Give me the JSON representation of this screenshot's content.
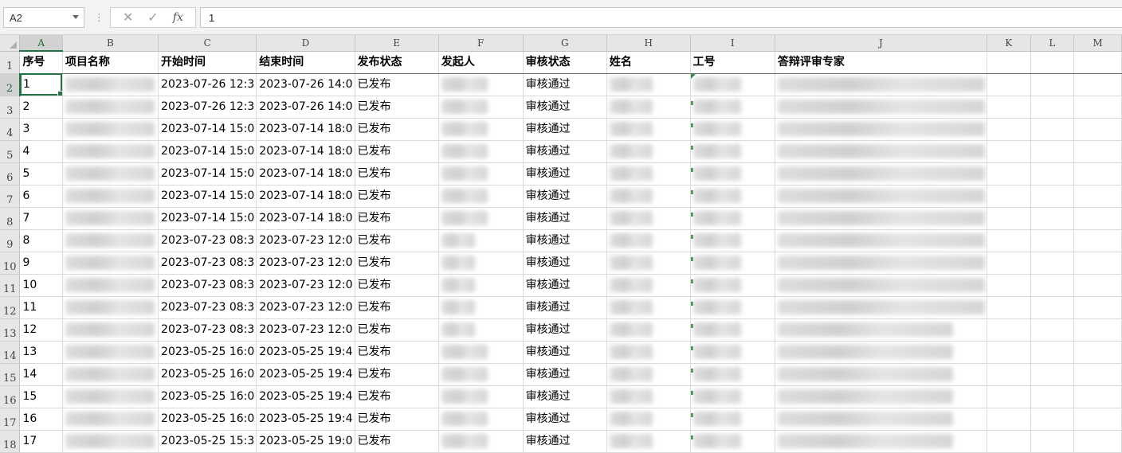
{
  "formula_bar": {
    "name_box": "A2",
    "cancel_icon": "✕",
    "enter_icon": "✓",
    "fx_label": "fx",
    "formula_value": "1"
  },
  "columns": [
    "A",
    "B",
    "C",
    "D",
    "E",
    "F",
    "G",
    "H",
    "I",
    "J",
    "K",
    "L",
    "M"
  ],
  "header_row": {
    "row_number": "1",
    "cells": [
      "序号",
      "项目名称",
      "开始时间",
      "结束时间",
      "发布状态",
      "发起人",
      "审核状态",
      "姓名",
      "工号",
      "答辩评审专家",
      "",
      "",
      ""
    ]
  },
  "rows": [
    {
      "row_number": "2",
      "seq": "1",
      "start": "2023-07-26 12:3",
      "end": "2023-07-26 14:0",
      "publish": "已发布",
      "review": "审核通过"
    },
    {
      "row_number": "3",
      "seq": "2",
      "start": "2023-07-26 12:3",
      "end": "2023-07-26 14:0",
      "publish": "已发布",
      "review": "审核通过"
    },
    {
      "row_number": "4",
      "seq": "3",
      "start": "2023-07-14 15:0",
      "end": "2023-07-14 18:0",
      "publish": "已发布",
      "review": "审核通过"
    },
    {
      "row_number": "5",
      "seq": "4",
      "start": "2023-07-14 15:0",
      "end": "2023-07-14 18:0",
      "publish": "已发布",
      "review": "审核通过"
    },
    {
      "row_number": "6",
      "seq": "5",
      "start": "2023-07-14 15:0",
      "end": "2023-07-14 18:0",
      "publish": "已发布",
      "review": "审核通过"
    },
    {
      "row_number": "7",
      "seq": "6",
      "start": "2023-07-14 15:0",
      "end": "2023-07-14 18:0",
      "publish": "已发布",
      "review": "审核通过"
    },
    {
      "row_number": "8",
      "seq": "7",
      "start": "2023-07-14 15:0",
      "end": "2023-07-14 18:0",
      "publish": "已发布",
      "review": "审核通过"
    },
    {
      "row_number": "9",
      "seq": "8",
      "start": "2023-07-23 08:3",
      "end": "2023-07-23 12:0",
      "publish": "已发布",
      "review": "审核通过"
    },
    {
      "row_number": "10",
      "seq": "9",
      "start": "2023-07-23 08:3",
      "end": "2023-07-23 12:0",
      "publish": "已发布",
      "review": "审核通过"
    },
    {
      "row_number": "11",
      "seq": "10",
      "start": "2023-07-23 08:3",
      "end": "2023-07-23 12:0",
      "publish": "已发布",
      "review": "审核通过"
    },
    {
      "row_number": "12",
      "seq": "11",
      "start": "2023-07-23 08:3",
      "end": "2023-07-23 12:0",
      "publish": "已发布",
      "review": "审核通过"
    },
    {
      "row_number": "13",
      "seq": "12",
      "start": "2023-07-23 08:3",
      "end": "2023-07-23 12:0",
      "publish": "已发布",
      "review": "审核通过"
    },
    {
      "row_number": "14",
      "seq": "13",
      "start": "2023-05-25 16:0",
      "end": "2023-05-25 19:4",
      "publish": "已发布",
      "review": "审核通过"
    },
    {
      "row_number": "15",
      "seq": "14",
      "start": "2023-05-25 16:0",
      "end": "2023-05-25 19:4",
      "publish": "已发布",
      "review": "审核通过"
    },
    {
      "row_number": "16",
      "seq": "15",
      "start": "2023-05-25 16:0",
      "end": "2023-05-25 19:4",
      "publish": "已发布",
      "review": "审核通过"
    },
    {
      "row_number": "17",
      "seq": "16",
      "start": "2023-05-25 16:0",
      "end": "2023-05-25 19:4",
      "publish": "已发布",
      "review": "审核通过"
    },
    {
      "row_number": "18",
      "seq": "17",
      "start": "2023-05-25 15:3",
      "end": "2023-05-25 19:0",
      "publish": "已发布",
      "review": "审核通过"
    }
  ],
  "colors": {
    "accent": "#217346",
    "header_bg": "#e6e6e6",
    "gridline": "#dadada"
  }
}
